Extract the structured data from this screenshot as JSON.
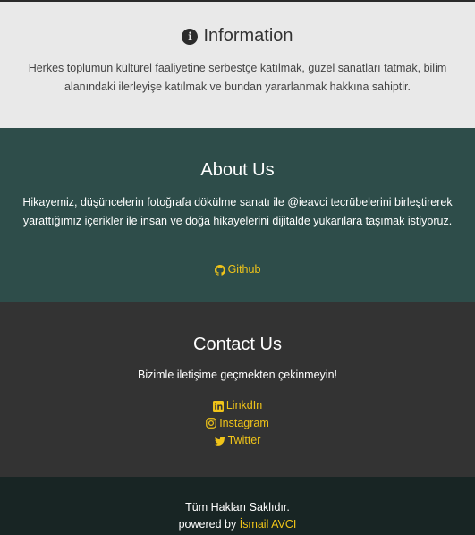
{
  "info": {
    "title": "Information",
    "text": "Herkes toplumun kültürel faaliyetine serbestçe katılmak, güzel sanatları tatmak, bilim alanındaki ilerleyişe katılmak ve bundan yararlanmak hakkına sahiptir."
  },
  "about": {
    "title": "About Us",
    "text": "Hikayemiz, düşüncelerin fotoğrafa dökülme sanatı ile @ieavci tecrübelerini birleştirerek yarattığımız içerikler ile insan ve doğa hikayelerini dijitalde yukarılara taşımak istiyoruz.",
    "github_label": "Github"
  },
  "contact": {
    "title": "Contact Us",
    "text": "Bizimle iletişime geçmekten çekinmeyin!",
    "links": [
      {
        "label": "LinkdIn",
        "icon": "linkedin-icon"
      },
      {
        "label": "Instagram",
        "icon": "instagram-icon"
      },
      {
        "label": "Twitter",
        "icon": "twitter-icon"
      }
    ]
  },
  "footer": {
    "rights": "Tüm Hakları Saklıdır.",
    "powered_prefix": "powered by",
    "author": "İsmail AVCI"
  },
  "colors": {
    "accent": "#f0c419",
    "info_bg": "#e9e9e9",
    "about_bg": "#2e4d4a",
    "contact_bg": "#333333",
    "footer_bg": "#182524"
  }
}
